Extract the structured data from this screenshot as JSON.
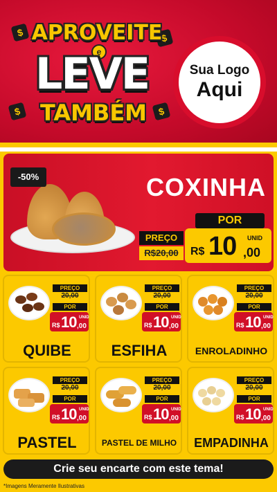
{
  "header": {
    "word1": "APROVEITE",
    "connector": "e",
    "word2": "LEVE",
    "word3": "TAMBÉM",
    "coin_symbol": "$",
    "logo_line1": "Sua Logo",
    "logo_line2": "Aqui"
  },
  "hero": {
    "discount": "-50%",
    "name": "COXINHA",
    "preco_label": "PREÇO",
    "old_price": "R$20,00",
    "por_label": "POR",
    "currency": "R$",
    "price_int": "10",
    "price_dec": ",00",
    "unit": "UNID"
  },
  "products": [
    {
      "name": "QUIBE",
      "preco_label": "PREÇO",
      "old_price": "20,00",
      "por_label": "POR",
      "currency": "R$",
      "price_int": "10",
      "price_dec": ",00",
      "unit": "UNID"
    },
    {
      "name": "ESFIHA",
      "preco_label": "PREÇO",
      "old_price": "20,00",
      "por_label": "POR",
      "currency": "R$",
      "price_int": "10",
      "price_dec": ",00",
      "unit": "UNID"
    },
    {
      "name": "ENROLADINHO",
      "preco_label": "PREÇO",
      "old_price": "20,00",
      "por_label": "POR",
      "currency": "R$",
      "price_int": "10",
      "price_dec": ",00",
      "unit": "UNID"
    },
    {
      "name": "PASTEL",
      "preco_label": "PREÇO",
      "old_price": "20,00",
      "por_label": "POR",
      "currency": "R$",
      "price_int": "10",
      "price_dec": ",00",
      "unit": "UNID"
    },
    {
      "name": "PASTEL DE MILHO",
      "preco_label": "PREÇO",
      "old_price": "20,00",
      "por_label": "POR",
      "currency": "R$",
      "price_int": "10",
      "price_dec": ",00",
      "unit": "UNID"
    },
    {
      "name": "EMPADINHA",
      "preco_label": "PREÇO",
      "old_price": "20,00",
      "por_label": "POR",
      "currency": "R$",
      "price_int": "10",
      "price_dec": ",00",
      "unit": "UNID"
    }
  ],
  "footer": {
    "cta": "Crie seu encarte com este tema!",
    "disclaimer": "*Imagens Meramente Ilustrativas"
  },
  "colors": {
    "red": "#d80d2c",
    "yellow": "#fcc900",
    "black": "#111111"
  }
}
